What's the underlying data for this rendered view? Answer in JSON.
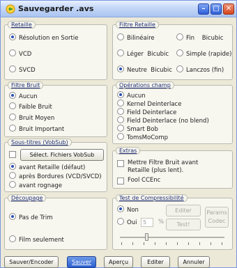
{
  "window": {
    "title": "Sauvegarder .avs",
    "minimize": "–",
    "maximize": "□",
    "close": "✕"
  },
  "resize": {
    "title": "Retaille",
    "options": [
      "Résolution en Sortie",
      "VCD",
      "SVCD"
    ],
    "selected": "Résolution en Sortie"
  },
  "resize_filter": {
    "title": "Filtre Retaille",
    "options": [
      "Bilinéaire",
      "Fin",
      "Bicubic",
      "Léger  Bicubic",
      "Simple (rapide)",
      "Neutre  Bicubic",
      "Lanczos (fin)"
    ],
    "selected": "Neutre  Bicubic"
  },
  "noise_filter": {
    "title": "Filtre Bruit",
    "options": [
      "Aucun",
      "Faible Bruit",
      "Bruit Moyen",
      "Bruit Important"
    ],
    "selected": "Aucun"
  },
  "field_ops": {
    "title": "Opérations champ",
    "options": [
      "Aucun",
      "Kernel Deinterlace",
      "Field Deinterlace",
      "Field Deinterlace (no blend)",
      "Smart Bob",
      "TomsMoComp"
    ],
    "selected": "Aucun"
  },
  "subtitles": {
    "title": "Sous-titres (VobSub)",
    "select_button": "Sélect. Fichiers VobSub",
    "options": [
      "avant Retaille (défaut)",
      "après Bordures (VCD/SVCD)",
      "avant rognage"
    ],
    "selected": "avant Retaille (défaut)"
  },
  "extras": {
    "title": "Extras",
    "noise_before_line1": "Mettre Filtre Bruit avant",
    "noise_before_line2": "Retaille (plus lent).",
    "fool_ccenc": "Fool CCEnc"
  },
  "cutting": {
    "title": "Découpage",
    "options": [
      "Pas de Trim",
      "Film seulement"
    ],
    "selected": "Pas de Trim"
  },
  "compressibility": {
    "title": "Test de Compressibilité",
    "no": "Non",
    "yes": "Oui",
    "selected": "Non",
    "value": "5",
    "unit": "%",
    "edit_button": "Editer",
    "test_button": "Test!",
    "params_line1": "Params",
    "params_line2": "Codec"
  },
  "footer": {
    "save_encode": "Sauver/Encoder",
    "save": "Sauver",
    "preview": "Aperçu",
    "edit": "Editer",
    "cancel": "Annuler"
  }
}
